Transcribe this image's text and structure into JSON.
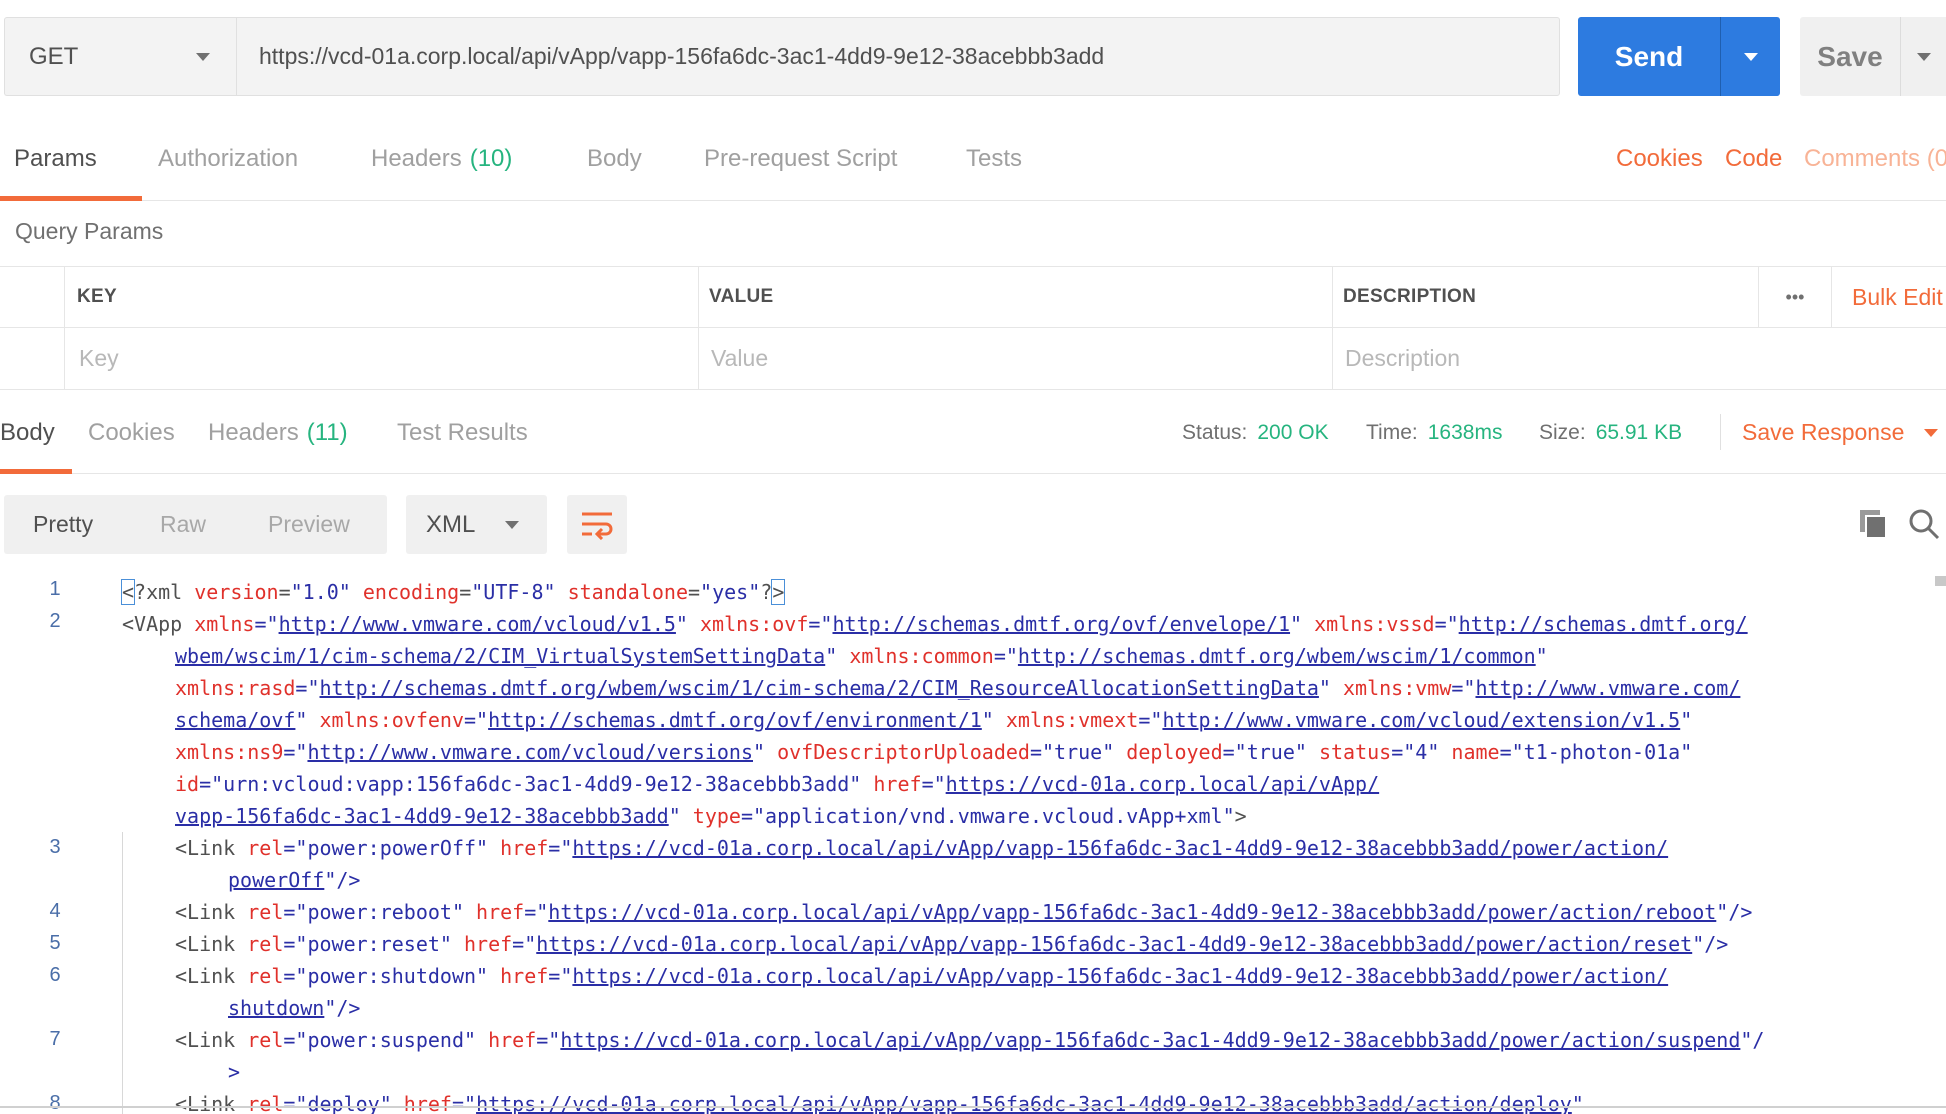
{
  "request": {
    "method": "GET",
    "url": "https://vcd-01a.corp.local/api/vApp/vapp-156fa6dc-3ac1-4dd9-9e12-38acebbb3add",
    "send_label": "Send",
    "save_label": "Save"
  },
  "request_tabs": {
    "params": "Params",
    "authorization": "Authorization",
    "headers": "Headers",
    "headers_count": "(10)",
    "body": "Body",
    "prerequest": "Pre-request Script",
    "tests": "Tests",
    "cookies": "Cookies",
    "code": "Code",
    "comments": "Comments (0"
  },
  "query_params": {
    "title": "Query Params",
    "columns": {
      "key": "KEY",
      "value": "VALUE",
      "description": "DESCRIPTION"
    },
    "more": "•••",
    "bulk_edit": "Bulk Edit",
    "placeholders": {
      "key": "Key",
      "value": "Value",
      "description": "Description"
    }
  },
  "response": {
    "tabs": {
      "body": "Body",
      "cookies": "Cookies",
      "headers": "Headers",
      "headers_count": "(11)",
      "test_results": "Test Results"
    },
    "status_label": "Status:",
    "status_value": "200 OK",
    "time_label": "Time:",
    "time_value": "1638ms",
    "size_label": "Size:",
    "size_value": "65.91 KB",
    "save_response": "Save Response"
  },
  "body_view": {
    "modes": [
      "Pretty",
      "Raw",
      "Preview"
    ],
    "active_mode": "Pretty",
    "format": "XML"
  },
  "code_lines": {
    "n1": "1",
    "n2": "2",
    "n3": "3",
    "n4": "4",
    "n5": "5",
    "n6": "6",
    "n7": "7",
    "n8": "8",
    "l1": {
      "a": "<",
      "b": "?xml ",
      "c": "version",
      "d": "=",
      "e": "\"1.0\"",
      "f": " encoding",
      "g": "=",
      "h": "\"UTF-8\"",
      "i": " standalone",
      "j": "=",
      "k": "\"yes\"",
      "l": "?",
      "m": ">"
    },
    "l2": {
      "a": "<VApp ",
      "b": "xmlns",
      "c": "=\"",
      "d": "http://www.vmware.com/vcloud/v1.5",
      "e": "\" ",
      "f": "xmlns:ovf",
      "g": "=\"",
      "h": "http://schemas.dmtf.org/ovf/envelope/1",
      "i": "\" ",
      "j": "xmlns:vssd",
      "k": "=\"",
      "l": "http://schemas.dmtf.org/"
    },
    "l2b": {
      "a": "wbem/wscim/1/cim-schema/2/CIM_VirtualSystemSettingData",
      "b": "\" ",
      "c": "xmlns:common",
      "d": "=\"",
      "e": "http://schemas.dmtf.org/wbem/wscim/1/common",
      "f": "\""
    },
    "l2c": {
      "a": "xmlns:rasd",
      "b": "=\"",
      "c": "http://schemas.dmtf.org/wbem/wscim/1/cim-schema/2/CIM_ResourceAllocationSettingData",
      "d": "\" ",
      "e": "xmlns:vmw",
      "f": "=\"",
      "g": "http://www.vmware.com/"
    },
    "l2d": {
      "a": "schema/ovf",
      "b": "\" ",
      "c": "xmlns:ovfenv",
      "d": "=\"",
      "e": "http://schemas.dmtf.org/ovf/environment/1",
      "f": "\" ",
      "g": "xmlns:vmext",
      "h": "=\"",
      "i": "http://www.vmware.com/vcloud/extension/v1.5",
      "j": "\""
    },
    "l2e": {
      "a": "xmlns:ns9",
      "b": "=\"",
      "c": "http://www.vmware.com/vcloud/versions",
      "d": "\" ",
      "e": "ovfDescriptorUploaded",
      "f": "=\"true\" ",
      "g": "deployed",
      "h": "=\"true\" ",
      "i": "status",
      "j": "=\"4\" ",
      "k": "name",
      "l": "=\"t1-photon-01a\""
    },
    "l2f": {
      "a": "id",
      "b": "=\"urn:vcloud:vapp:156fa6dc-3ac1-4dd9-9e12-38acebbb3add\" ",
      "c": "href",
      "d": "=\"",
      "e": "https://vcd-01a.corp.local/api/vApp/"
    },
    "l2g": {
      "a": "vapp-156fa6dc-3ac1-4dd9-9e12-38acebbb3add",
      "b": "\" ",
      "c": "type",
      "d": "=\"application/vnd.vmware.vcloud.vApp+xml\"",
      "e": ">"
    },
    "l3": {
      "a": "<Link ",
      "b": "rel",
      "c": "=\"power:powerOff\" ",
      "d": "href",
      "e": "=\"",
      "f": "https://vcd-01a.corp.local/api/vApp/vapp-156fa6dc-3ac1-4dd9-9e12-38acebbb3add/power/action/"
    },
    "l3b": {
      "a": "powerOff",
      "b": "\"/>"
    },
    "l4": {
      "a": "<Link ",
      "b": "rel",
      "c": "=\"power:reboot\" ",
      "d": "href",
      "e": "=\"",
      "f": "https://vcd-01a.corp.local/api/vApp/vapp-156fa6dc-3ac1-4dd9-9e12-38acebbb3add/power/action/reboot",
      "g": "\"/>"
    },
    "l5": {
      "a": "<Link ",
      "b": "rel",
      "c": "=\"power:reset\" ",
      "d": "href",
      "e": "=\"",
      "f": "https://vcd-01a.corp.local/api/vApp/vapp-156fa6dc-3ac1-4dd9-9e12-38acebbb3add/power/action/reset",
      "g": "\"/>"
    },
    "l6": {
      "a": "<Link ",
      "b": "rel",
      "c": "=\"power:shutdown\" ",
      "d": "href",
      "e": "=\"",
      "f": "https://vcd-01a.corp.local/api/vApp/vapp-156fa6dc-3ac1-4dd9-9e12-38acebbb3add/power/action/"
    },
    "l6b": {
      "a": "shutdown",
      "b": "\"/>"
    },
    "l7": {
      "a": "<Link ",
      "b": "rel",
      "c": "=\"power:suspend\" ",
      "d": "href",
      "e": "=\"",
      "f": "https://vcd-01a.corp.local/api/vApp/vapp-156fa6dc-3ac1-4dd9-9e12-38acebbb3add/power/action/suspend",
      "g": "\"/"
    },
    "l7b": {
      "a": ">"
    },
    "l8": {
      "a": "<Link ",
      "b": "rel",
      "c": "=\"deploy\" ",
      "d": "href",
      "e": "=\"",
      "f": "https://vcd-01a.corp.local/api/vApp/vapp-156fa6dc-3ac1-4dd9-9e12-38acebbb3add/action/deploy",
      "g": "\""
    }
  },
  "colors": {
    "accent_orange": "#f26b3a",
    "send_blue": "#2d7be0",
    "status_green": "#26b47f",
    "xml_attr": "#e0312b",
    "xml_string": "#2a2ea6"
  },
  "icons": [
    "chevron-down-icon",
    "more-icon",
    "wrap-lines-icon",
    "copy-icon",
    "search-icon"
  ]
}
